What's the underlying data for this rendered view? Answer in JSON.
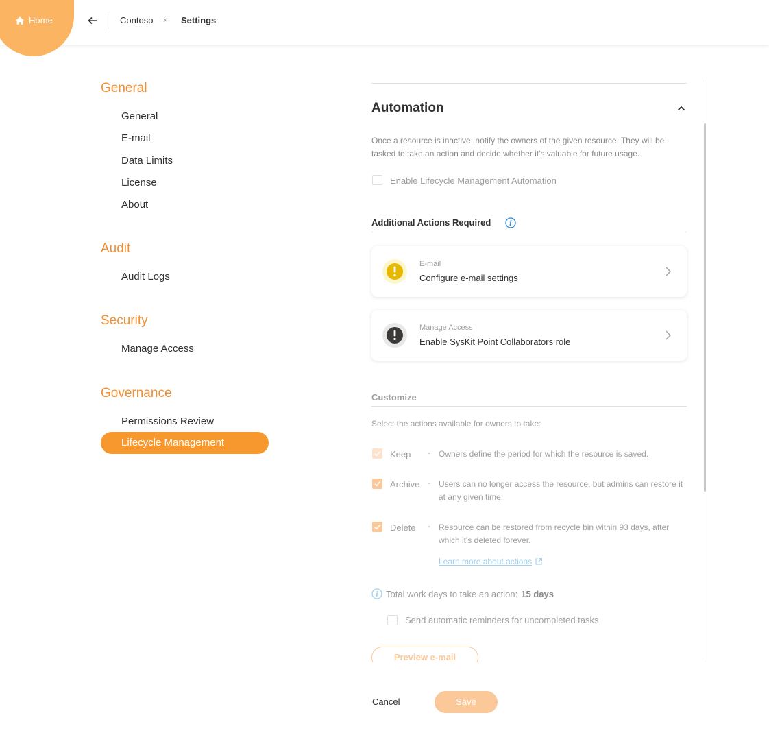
{
  "topbar": {
    "home_label": "Home",
    "breadcrumb": [
      "Contoso",
      "Settings"
    ],
    "accent": "#fbb462"
  },
  "nav": {
    "sections": [
      {
        "heading": "General",
        "items": [
          "General",
          "E-mail",
          "Data Limits",
          "License",
          "About"
        ]
      },
      {
        "heading": "Audit",
        "items": [
          "Audit Logs"
        ]
      },
      {
        "heading": "Security",
        "items": [
          "Manage Access"
        ]
      },
      {
        "heading": "Governance",
        "items": [
          "Permissions Review",
          "Lifecycle Management"
        ]
      }
    ],
    "active_item": "Lifecycle Management",
    "accent": "#f28f33"
  },
  "automation": {
    "title": "Automation",
    "description": "Once a resource is inactive, notify the owners of the given resource. They will be tasked to take an action and decide whether it's valuable for future usage.",
    "enable_label": "Enable Lifecycle Management Automation",
    "enable_checked": false
  },
  "additional_actions": {
    "title": "Additional Actions Required",
    "cards": [
      {
        "category": "E-mail",
        "title": "Configure e-mail settings",
        "icon": "warning-icon",
        "icon_color": "#e6b800"
      },
      {
        "category": "Manage Access",
        "title": "Enable SysKit Point Collaborators role",
        "icon": "error-icon",
        "icon_color": "#3b3a39"
      }
    ]
  },
  "customize": {
    "title": "Customize",
    "prompt": "Select the actions available for owners to take:",
    "actions": [
      {
        "name": "Keep",
        "dash": "-",
        "description": "Owners define the period for which the resource is saved.",
        "checked": true
      },
      {
        "name": "Archive",
        "dash": "-",
        "description": "Users can no longer access the resource, but admins can restore it at any given time.",
        "checked": true
      },
      {
        "name": "Delete",
        "dash": "-",
        "description": "Resource can be restored from recycle bin within 93 days, after which it's deleted forever.",
        "checked": true
      }
    ],
    "learn_more": "Learn more about actions",
    "total_label": "Total work days to take an action:",
    "total_value": "15 days",
    "reminders_label": "Send automatic reminders for uncompleted tasks",
    "reminders_checked": false,
    "preview_label": "Preview e-mail"
  },
  "footer": {
    "cancel_label": "Cancel",
    "save_label": "Save"
  }
}
